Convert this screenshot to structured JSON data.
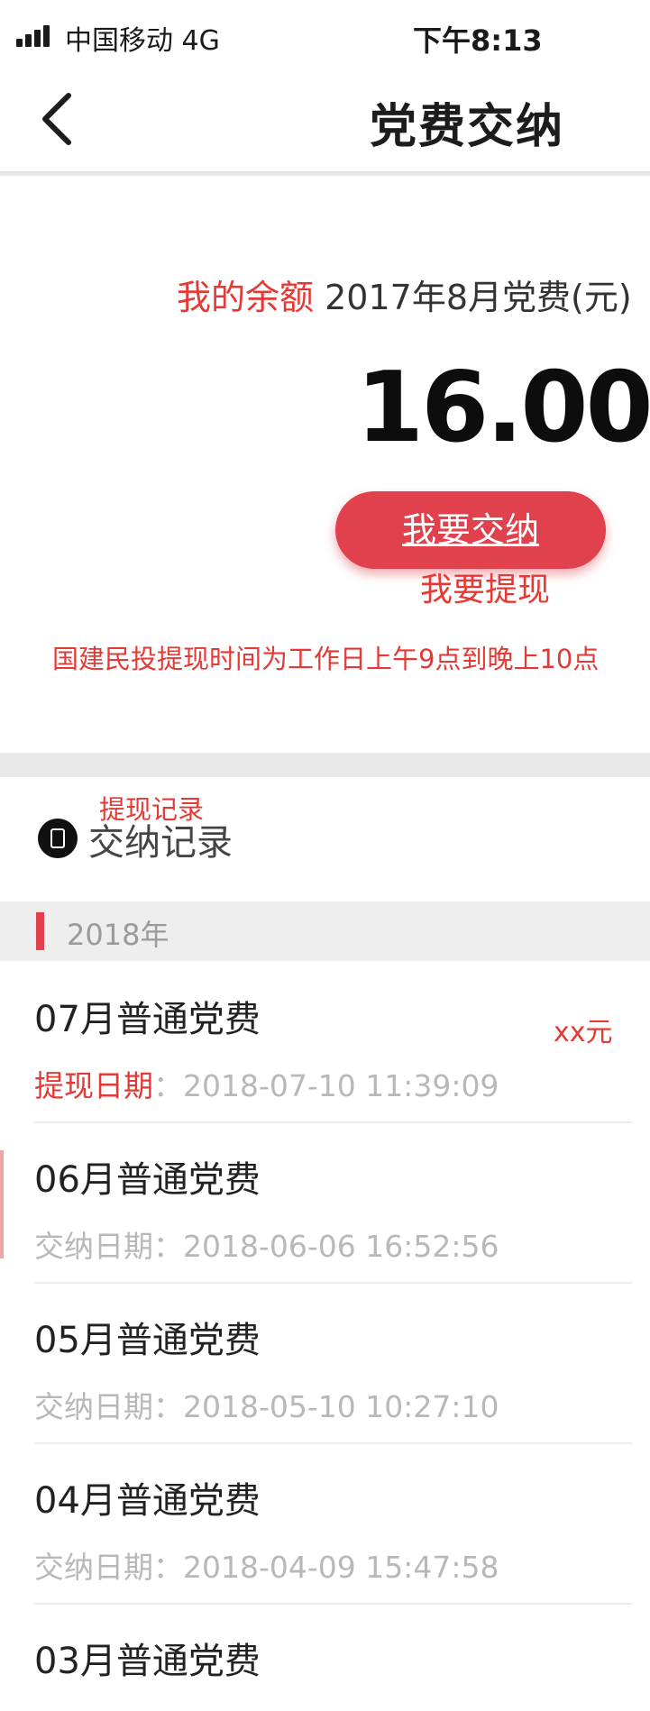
{
  "status_bar": {
    "carrier": "中国移动 4G",
    "time": "下午8:13"
  },
  "nav": {
    "title": "党费交纳",
    "back_icon": "chevron-left-icon"
  },
  "balance": {
    "label_red": "我的余额",
    "label_dark": "2017年8月党费(元)",
    "amount": "16.00",
    "pay_button": "我要交纳",
    "withdraw_label": "我要提现",
    "notice": "国建民投提现时间为工作日上午9点到晚上10点"
  },
  "records": {
    "withdraw_label": "提现记录",
    "title": "交纳记录",
    "year": "2018年",
    "items": [
      {
        "title": "07月普通党费",
        "date_label": "提现日期",
        "date_value": "：2018-07-10 11:39:09",
        "amount": "xx元"
      },
      {
        "title": "06月普通党费",
        "date_label": "交纳日期",
        "date_value": "：2018-06-06 16:52:56"
      },
      {
        "title": "05月普通党费",
        "date_label": "交纳日期",
        "date_value": "：2018-05-10 10:27:10"
      },
      {
        "title": "04月普通党费",
        "date_label": "交纳日期",
        "date_value": "：2018-04-09 15:47:58"
      },
      {
        "title": "03月普通党费"
      }
    ]
  },
  "colors": {
    "accent_red": "#e0414c",
    "annotation_red": "#e53935"
  }
}
